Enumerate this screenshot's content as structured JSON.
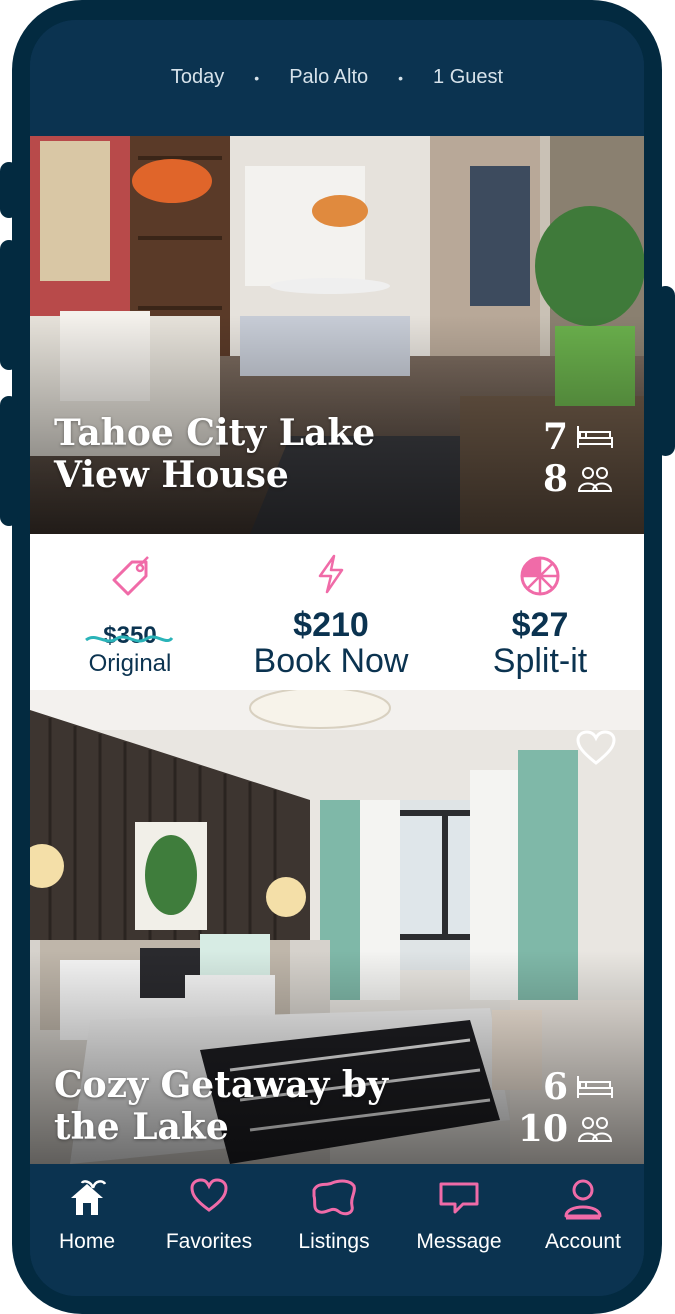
{
  "search": {
    "date": "Today",
    "location": "Palo Alto",
    "guests": "1 Guest"
  },
  "listings": [
    {
      "title_line1": "Tahoe City Lake",
      "title_line2": "View House",
      "beds": "7",
      "guests": "8",
      "favorited": false
    },
    {
      "title_line1": "Cozy Getaway by",
      "title_line2": "the Lake",
      "beds": "6",
      "guests": "10",
      "favorited": false
    }
  ],
  "pricing": {
    "original_price": "$350",
    "original_label": "Original",
    "book_price": "$210",
    "book_label": "Book Now",
    "split_price": "$27",
    "split_label": "Split-it"
  },
  "nav": [
    {
      "label": "Home",
      "icon": "home-icon"
    },
    {
      "label": "Favorites",
      "icon": "heart-icon"
    },
    {
      "label": "Listings",
      "icon": "listings-icon"
    },
    {
      "label": "Message",
      "icon": "message-icon"
    },
    {
      "label": "Account",
      "icon": "account-icon"
    }
  ],
  "colors": {
    "navy": "#0b3350",
    "accent_pink": "#f06ba8",
    "white": "#ffffff"
  }
}
